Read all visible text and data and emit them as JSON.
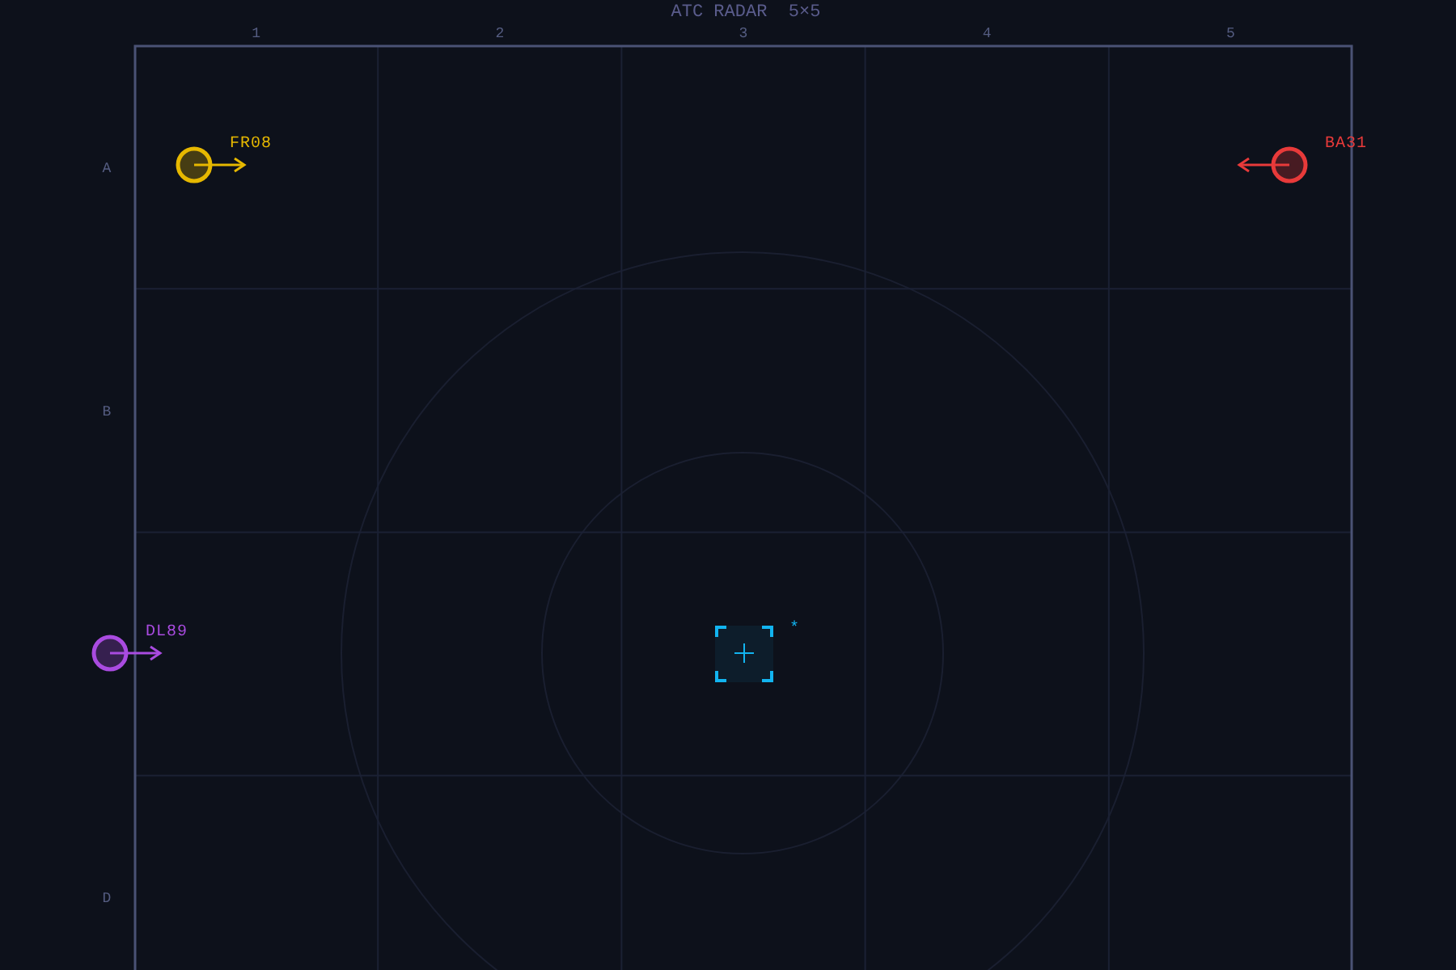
{
  "title": "ATC RADAR  5×5",
  "column_labels": [
    "1",
    "2",
    "3",
    "4",
    "5"
  ],
  "row_labels": [
    "A",
    "B",
    "D"
  ],
  "flights": [
    {
      "callsign": "FR08",
      "color": "#e6b800",
      "facing_left": false
    },
    {
      "callsign": "BA31",
      "color": "#e83a3a",
      "facing_left": true
    },
    {
      "callsign": "DL89",
      "color": "#a94be0",
      "facing_left": false
    }
  ],
  "center_marker": {
    "mark": "*"
  }
}
